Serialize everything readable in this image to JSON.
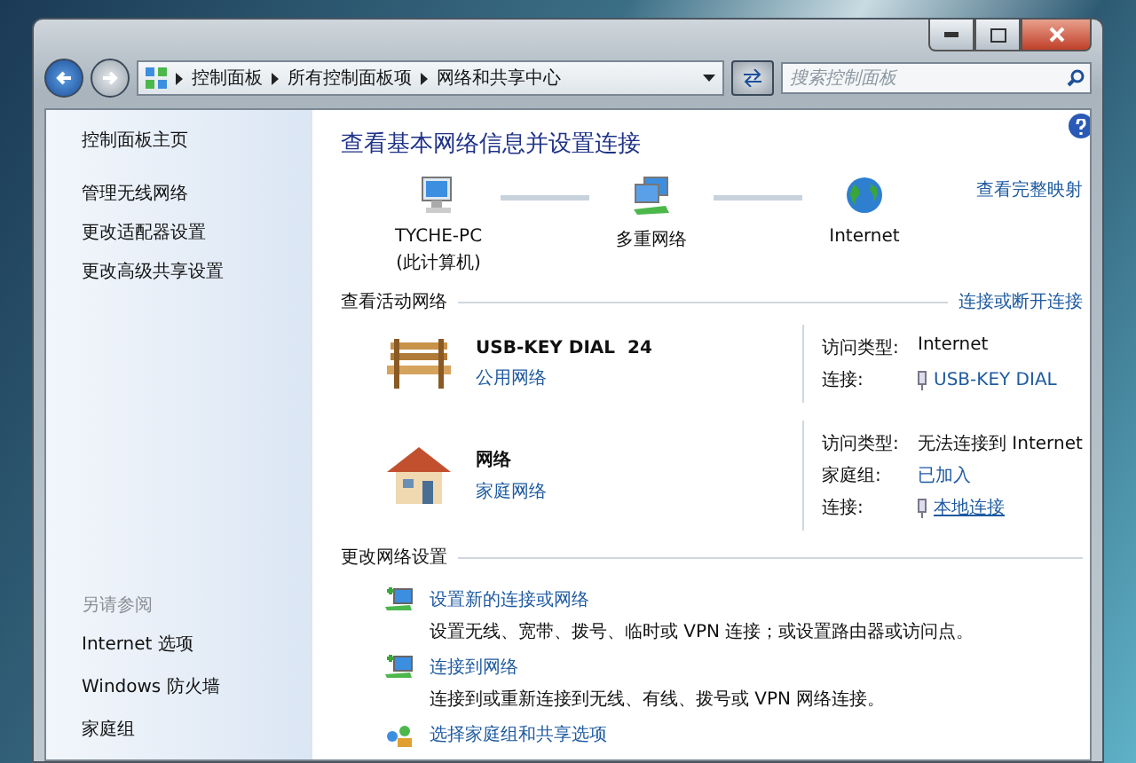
{
  "address_bar": {
    "breadcrumbs": [
      "控制面板",
      "所有控制面板项",
      "网络和共享中心"
    ]
  },
  "search": {
    "placeholder": "搜索控制面板"
  },
  "sidebar": {
    "items": [
      "控制面板主页",
      "管理无线网络",
      "更改适配器设置",
      "更改高级共享设置"
    ],
    "see_also": {
      "heading": "另请参阅",
      "links": [
        "Internet 选项",
        "Windows 防火墙",
        "家庭组"
      ]
    }
  },
  "main": {
    "title": "查看基本网络信息并设置连接",
    "map": {
      "nodes": [
        {
          "kind": "computer",
          "name": "TYCHE-PC",
          "sub": "(此计算机)"
        },
        {
          "kind": "network",
          "name": "多重网络"
        },
        {
          "kind": "globe",
          "name": "Internet"
        }
      ],
      "link": "查看完整映射"
    },
    "active_networks": {
      "heading": "查看活动网络",
      "link": "连接或断开连接",
      "networks": [
        {
          "kind": "bench",
          "name": "USB-KEY DIAL  24",
          "type": "公用网络",
          "details": [
            {
              "kind": "text",
              "label": "访问类型:",
              "value": "Internet"
            },
            {
              "kind": "adapter",
              "label": "连接:",
              "value": "USB-KEY DIAL"
            }
          ]
        },
        {
          "kind": "house",
          "name": "网络",
          "type": "家庭网络",
          "details": [
            {
              "kind": "text",
              "label": "访问类型:",
              "value": "无法连接到 Internet"
            },
            {
              "kind": "link",
              "label": "家庭组:",
              "value": "已加入"
            },
            {
              "kind": "adapter",
              "label": "连接:",
              "value": "本地连接"
            }
          ]
        }
      ]
    },
    "settings": {
      "heading": "更改网络设置",
      "tasks": [
        {
          "kind": "setup",
          "title": "设置新的连接或网络",
          "description": "设置无线、宽带、拨号、临时或 VPN 连接；或设置路由器或访问点。"
        },
        {
          "kind": "connect",
          "title": "连接到网络",
          "description": "连接到或重新连接到无线、有线、拨号或 VPN 网络连接。"
        },
        {
          "kind": "homegroup",
          "title": "选择家庭组和共享选项"
        }
      ]
    }
  }
}
